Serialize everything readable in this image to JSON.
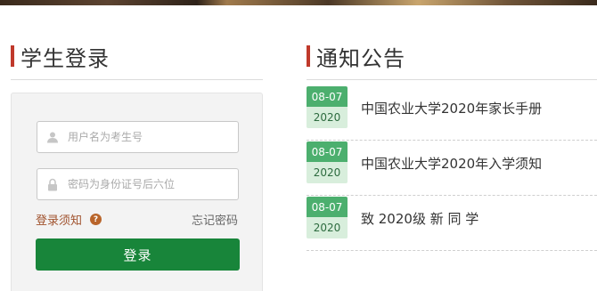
{
  "login": {
    "title": "学生登录",
    "username_placeholder": "用户名为考生号",
    "password_placeholder": "密码为身份证号后六位",
    "notice_link": "登录须知",
    "help_mark": "?",
    "forgot_link": "忘记密码",
    "submit_label": "登录",
    "icons": {
      "user": "user-icon",
      "lock": "lock-icon",
      "help": "question-icon"
    },
    "button_color": "#18853a"
  },
  "notices": {
    "title": "通知公告",
    "items": [
      {
        "date": "08-07",
        "year": "2020",
        "text": "中国农业大学2020年家长手册"
      },
      {
        "date": "08-07",
        "year": "2020",
        "text": "中国农业大学2020年入学须知"
      },
      {
        "date": "08-07",
        "year": "2020",
        "text": "致 2020级 新 同 学"
      }
    ],
    "badge_color": "#4caf6e"
  },
  "accent_color": "#c0392b"
}
